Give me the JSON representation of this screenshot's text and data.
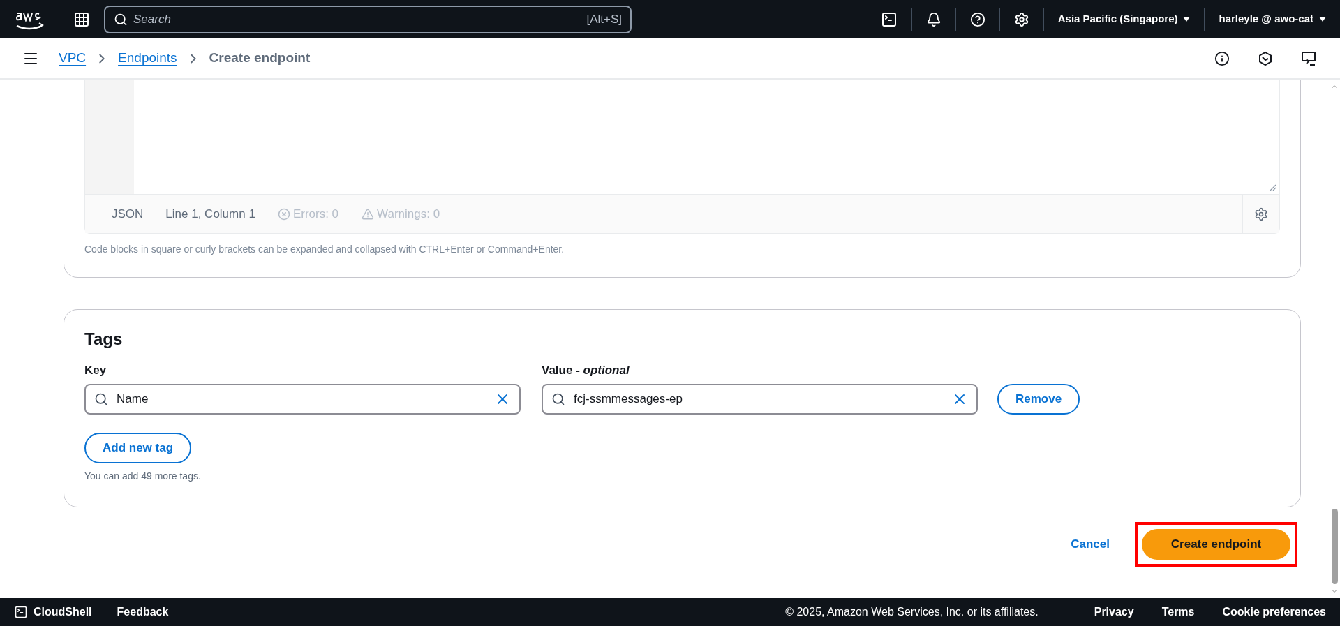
{
  "top_bar": {
    "search": {
      "placeholder": "Search",
      "shortcut": "[Alt+S]"
    },
    "region": "Asia Pacific (Singapore)",
    "account": "harleyle @ awo-cat"
  },
  "breadcrumbs": [
    {
      "label": "VPC",
      "link": true
    },
    {
      "label": "Endpoints",
      "link": true
    },
    {
      "label": "Create endpoint",
      "link": false
    }
  ],
  "editor": {
    "language": "JSON",
    "position": "Line 1, Column 1",
    "errors": "Errors: 0",
    "warnings": "Warnings: 0",
    "hint": "Code blocks in square or curly brackets can be expanded and collapsed with CTRL+Enter or Command+Enter."
  },
  "tags": {
    "title": "Tags",
    "key_label": "Key",
    "value_label": "Value - *optional*",
    "rows": [
      {
        "key": "Name",
        "value": "fcj-ssmmessages-ep",
        "remove": "Remove"
      }
    ],
    "add_button": "Add new tag",
    "note": "You can add 49 more tags."
  },
  "actions": {
    "cancel": "Cancel",
    "submit": "Create endpoint",
    "submit_highlighted": true
  },
  "footer": {
    "cloudshell": "CloudShell",
    "feedback": "Feedback",
    "copyright": "© 2025, Amazon Web Services, Inc. or its affiliates.",
    "links": [
      "Privacy",
      "Terms",
      "Cookie preferences"
    ]
  }
}
